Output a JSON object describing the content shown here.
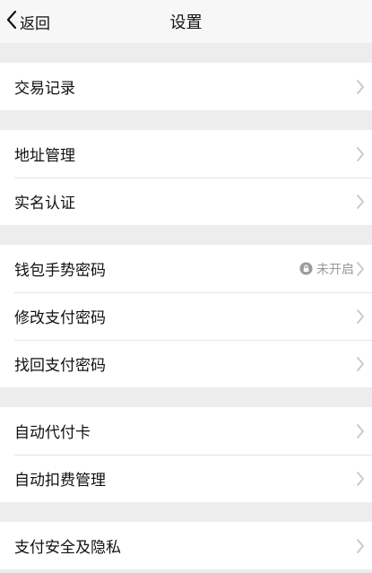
{
  "nav": {
    "back_label": "返回",
    "title": "设置"
  },
  "groups": [
    {
      "items": [
        {
          "label": "交易记录"
        }
      ]
    },
    {
      "items": [
        {
          "label": "地址管理"
        },
        {
          "label": "实名认证"
        }
      ]
    },
    {
      "items": [
        {
          "label": "钱包手势密码",
          "status": "未开启",
          "status_icon": "lock-icon"
        },
        {
          "label": "修改支付密码"
        },
        {
          "label": "找回支付密码"
        }
      ]
    },
    {
      "items": [
        {
          "label": "自动代付卡"
        },
        {
          "label": "自动扣费管理"
        }
      ]
    },
    {
      "items": [
        {
          "label": "支付安全及隐私"
        }
      ]
    }
  ],
  "colors": {
    "background": "#ededed",
    "row": "#ffffff",
    "text": "#111111",
    "muted": "#999999",
    "chevron": "#c7c7cc"
  }
}
